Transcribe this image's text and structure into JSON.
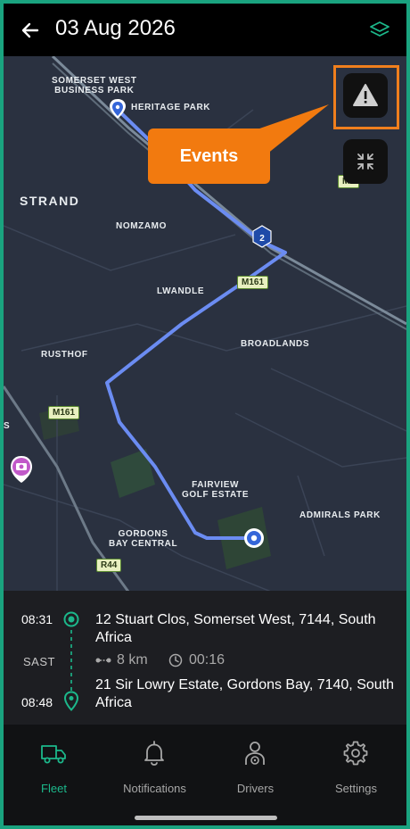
{
  "header": {
    "title": "03 Aug 2026"
  },
  "map": {
    "labels": {
      "somerset": "SOMERSET WEST\nBUSINESS PARK",
      "heritage": "HERITAGE PARK",
      "strand": "STRAND",
      "nomzamo": "NOMZAMO",
      "lwandle": "LWANDLE",
      "broadlands": "BROADLANDS",
      "rusthof": "RUSTHOF",
      "fairview": "FAIRVIEW\nGOLF ESTATE",
      "admirals": "ADMIRALS PARK",
      "gordons": "GORDONS\nBAY CENTRAL",
      "s": "S"
    },
    "shields": {
      "m161a": "M161",
      "m161b": "M161",
      "r44": "R44",
      "n2": "2",
      "partial": "M1"
    },
    "callout": "Events"
  },
  "trip": {
    "start_time": "08:31",
    "start_address": "12 Stuart Clos, Somerset West, 7144, South Africa",
    "timezone": "SAST",
    "distance": "8 km",
    "duration": "00:16",
    "end_time": "08:48",
    "end_address": "21 Sir Lowry Estate, Gordons Bay, 7140, South Africa"
  },
  "nav": {
    "fleet": "Fleet",
    "notifications": "Notifications",
    "drivers": "Drivers",
    "settings": "Settings"
  },
  "colors": {
    "accent": "#1cb88b",
    "route": "#6b8cf2",
    "callout": "#f27a0f",
    "map_bg": "#2a3140"
  }
}
